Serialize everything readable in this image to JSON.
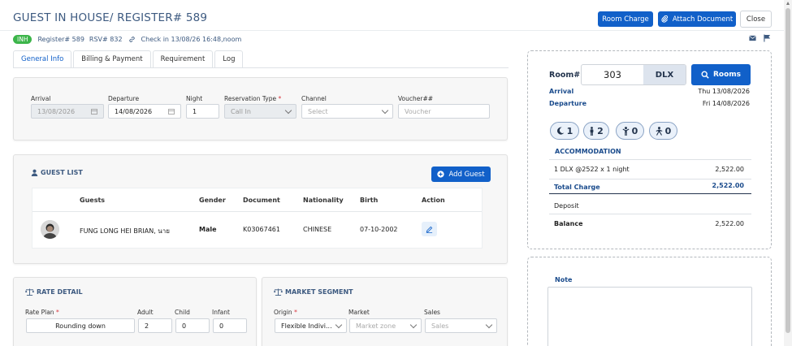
{
  "header": {
    "title": "GUEST IN HOUSE/ REGISTER# 589",
    "room_charge": "Room Charge",
    "attach_document": "Attach Document",
    "close": "Close"
  },
  "sub": {
    "badge": "INH",
    "register": "Register# 589",
    "rsv": "RSV# 832",
    "checkin": "Check in 13/08/26 16:48,noom"
  },
  "tabs": [
    "General Info",
    "Billing & Payment",
    "Requirement",
    "Log"
  ],
  "stay": {
    "arrival_label": "Arrival",
    "arrival_value": "13/08/2026",
    "departure_label": "Departure",
    "departure_value": "14/08/2026",
    "night_label": "Night",
    "night_value": "1",
    "reservation_type_label": "Reservation Type",
    "reservation_type_value": "Call In",
    "channel_label": "Channel",
    "channel_placeholder": "Select",
    "voucher_label": "Voucher##",
    "voucher_placeholder": "Voucher",
    "required_mark": "*"
  },
  "guest_list": {
    "title": "GUEST LIST",
    "add_guest": "Add Guest",
    "columns": [
      "Guests",
      "Gender",
      "Document",
      "Nationality",
      "Birth",
      "Action"
    ],
    "rows": [
      {
        "name": "FUNG LONG HEI BRIAN, นาย",
        "gender": "Male",
        "document": "K03067461",
        "nationality": "CHINESE",
        "birth": "07-10-2002"
      }
    ]
  },
  "rate_detail": {
    "title": "RATE DETAIL",
    "rate_plan_label": "Rate Plan",
    "rate_plan_value": "Rounding down",
    "adult_label": "Adult",
    "adult_value": "2",
    "child_label": "Child",
    "child_value": "0",
    "infant_label": "Infant",
    "infant_value": "0"
  },
  "market_segment": {
    "title": "MARKET SEGMENT",
    "origin_label": "Origin",
    "origin_value": "Flexible Indivi...",
    "market_label": "Market",
    "market_placeholder": "Market zone",
    "sales_label": "Sales",
    "sales_placeholder": "Sales"
  },
  "room": {
    "label": "Room#",
    "number": "303",
    "type": "DLX",
    "rooms_button": "Rooms",
    "arrival_label": "Arrival",
    "arrival_value": "Thu 13/08/2026",
    "departure_label": "Departure",
    "departure_value": "Fri 14/08/2026",
    "nights": "1",
    "adults": "2",
    "children": "0",
    "infants": "0"
  },
  "accommodation": {
    "title": "ACCOMMODATION",
    "line_desc": "1 DLX @2522 x 1 night",
    "line_amount": "2,522.00",
    "total_label": "Total Charge",
    "total_value": "2,522.00",
    "deposit_label": "Deposit",
    "balance_label": "Balance",
    "balance_value": "2,522.00"
  },
  "note": {
    "label": "Note"
  },
  "colors": {
    "primary": "#1160c9",
    "title": "#3d5a80",
    "badge": "#3cb54a"
  }
}
